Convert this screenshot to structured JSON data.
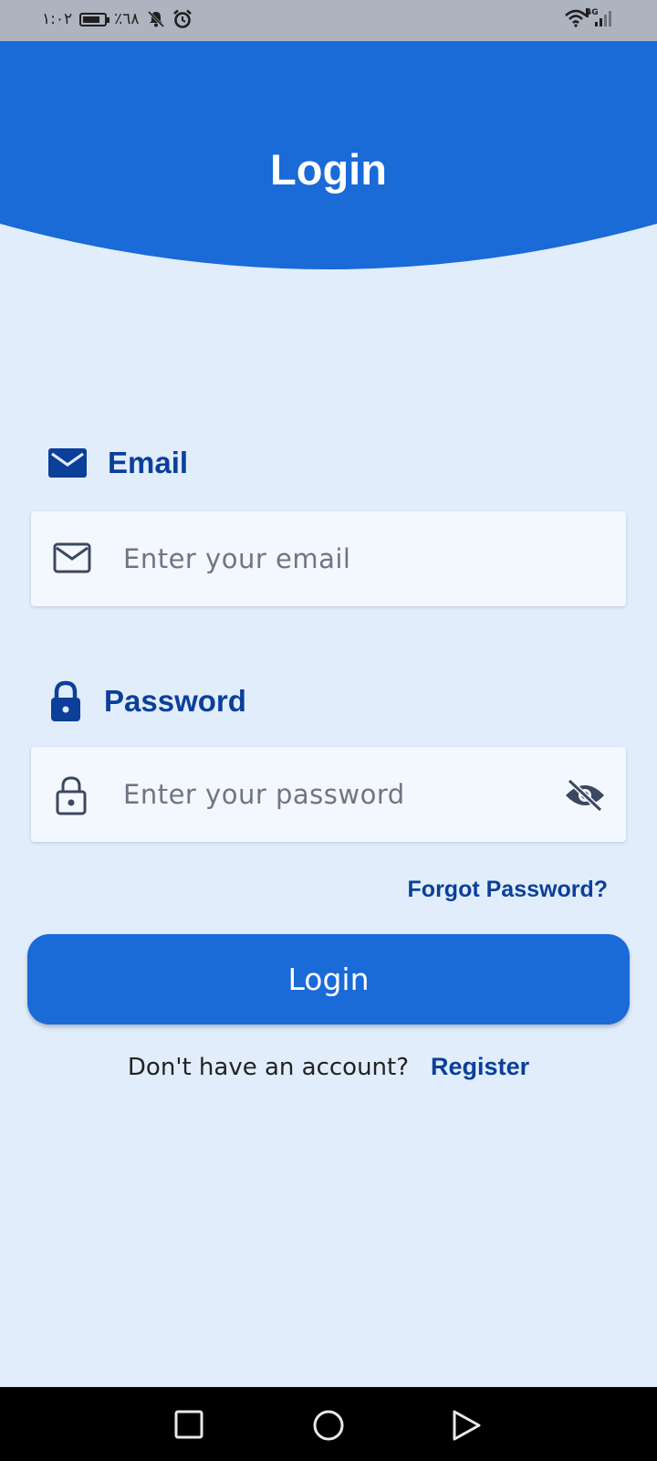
{
  "status_bar": {
    "time": "١:٠٢",
    "battery": "٪٦٨",
    "network": "4G"
  },
  "header": {
    "title": "Login",
    "color": "#1a6ad8"
  },
  "email": {
    "label": "Email",
    "placeholder": "Enter your email",
    "label_icon": "mail-filled-icon",
    "field_icon": "mail-outline-icon"
  },
  "password": {
    "label": "Password",
    "placeholder": "Enter your password",
    "label_icon": "lock-filled-icon",
    "field_icon": "lock-outline-icon",
    "toggle_icon": "eye-off-icon"
  },
  "forgot_password": "Forgot Password?",
  "login_button": "Login",
  "register_prompt": "Don't have an account?",
  "register_link": "Register",
  "nav": {
    "icons": [
      "square-icon",
      "circle-icon",
      "triangle-back-icon"
    ]
  },
  "colors": {
    "accent": "#1a6ad8",
    "label": "#0b3f9a",
    "background": "#e1edfb"
  }
}
